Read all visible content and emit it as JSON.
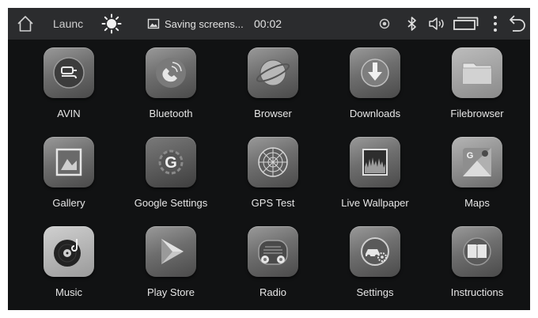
{
  "statusbar": {
    "app_title": "Launc",
    "notification_text": "Saving screens...",
    "time": "00:02"
  },
  "apps": [
    {
      "label": "AVIN",
      "icon": "avin-cable-icon"
    },
    {
      "label": "Bluetooth",
      "icon": "bluetooth-phone-icon"
    },
    {
      "label": "Browser",
      "icon": "browser-planet-icon"
    },
    {
      "label": "Downloads",
      "icon": "downloads-arrow-icon"
    },
    {
      "label": "Filebrowser",
      "icon": "filebrowser-folder-icon"
    },
    {
      "label": "Gallery",
      "icon": "gallery-picture-icon"
    },
    {
      "label": "Google Settings",
      "icon": "google-settings-icon"
    },
    {
      "label": "GPS Test",
      "icon": "gps-radar-icon"
    },
    {
      "label": "Live Wallpaper",
      "icon": "live-wallpaper-icon"
    },
    {
      "label": "Maps",
      "icon": "maps-icon"
    },
    {
      "label": "Music",
      "icon": "music-disc-icon"
    },
    {
      "label": "Play Store",
      "icon": "play-store-icon"
    },
    {
      "label": "Radio",
      "icon": "radio-icon"
    },
    {
      "label": "Settings",
      "icon": "settings-car-gear-icon"
    },
    {
      "label": "Instructions",
      "icon": "instructions-book-icon"
    }
  ]
}
